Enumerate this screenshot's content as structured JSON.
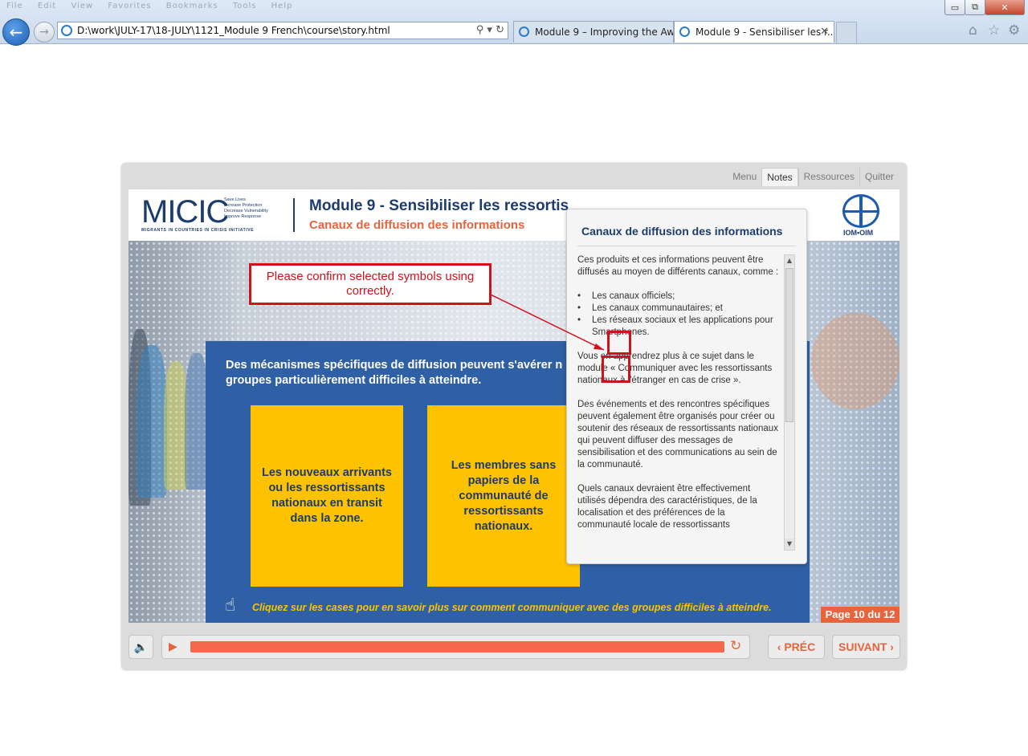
{
  "browser": {
    "menu": [
      "File",
      "Edit",
      "View",
      "Favorites",
      "Bookmarks",
      "Tools",
      "Help"
    ],
    "url": "D:\\work\\JULY-17\\18-JULY\\1121_Module 9 French\\course\\story.html",
    "tabs": [
      {
        "label": "Module 9 – Improving the Awa..."
      },
      {
        "label": "Module 9 - Sensibiliser les r..."
      }
    ],
    "window_buttons": {
      "minimize": "▭",
      "maximize": "⧉",
      "close": "✕"
    }
  },
  "player": {
    "nav": [
      "Menu",
      "Notes",
      "Ressources",
      "Quitter"
    ],
    "active_nav": "Notes"
  },
  "header": {
    "logo_text": "MICIC",
    "logo_tagline": [
      "Save Lives",
      "Increase Protection",
      "Decrease Vulnerability",
      "Improve Response"
    ],
    "logo_subtitle": "MIGRANTS IN COUNTRIES IN CRISIS INITIATIVE",
    "module_title": "Module 9 - Sensibiliser les ressortis",
    "module_subtitle": "Canaux de diffusion des informations",
    "partner_logo_text": "IOM•OIM"
  },
  "content": {
    "heading_line1": "Des mécanismes spécifiques de diffusion peuvent s'avérer nécessaires pour les",
    "heading_line2": "groupes particulièrement difficiles à atteindre.",
    "cards": [
      "Les nouveaux arrivants ou les ressortissants nationaux en transit dans la zone.",
      "Les membres sans papiers de la communauté de ressortissants nationaux."
    ],
    "instruction": "Cliquez sur les cases pour en savoir plus sur comment communiquer avec des groupes difficiles à atteindre."
  },
  "notes": {
    "title": "Canaux de diffusion des informations",
    "intro": "Ces produits et ces informations peuvent être diffusés au moyen de différents canaux, comme :",
    "bullets": [
      "Les canaux officiels;",
      "Les canaux communautaires; et",
      "Les réseaux sociaux et les applications pour Smartphones."
    ],
    "para2": "Vous en apprendrez plus à ce sujet dans le module « Communiquer avec les ressortissants nationaux à l'étranger en cas de crise ».",
    "para3": "Des événements et des rencontres spécifiques peuvent également être organisés pour créer ou soutenir des réseaux de ressortissants nationaux qui peuvent diffuser des messages de sensibilisation et des communications au sein de la communauté.",
    "para4": "Quels canaux devraient être effectivement utilisés dépendra des caractéristiques, de la localisation et des préférences de la communauté locale de ressortissants"
  },
  "annotation": {
    "text": "Please confirm selected symbols using correctly.",
    "color": "#d0121b"
  },
  "page_indicator": "Page 10 du 12",
  "controls": {
    "prev_label": "PRÉC",
    "next_label": "SUIVANT",
    "progress_fraction": 1.0
  },
  "colors": {
    "accent_orange": "#e8643c",
    "panel_blue": "#2f5fa5",
    "card_yellow": "#fec200",
    "navy": "#1d3c6e"
  }
}
